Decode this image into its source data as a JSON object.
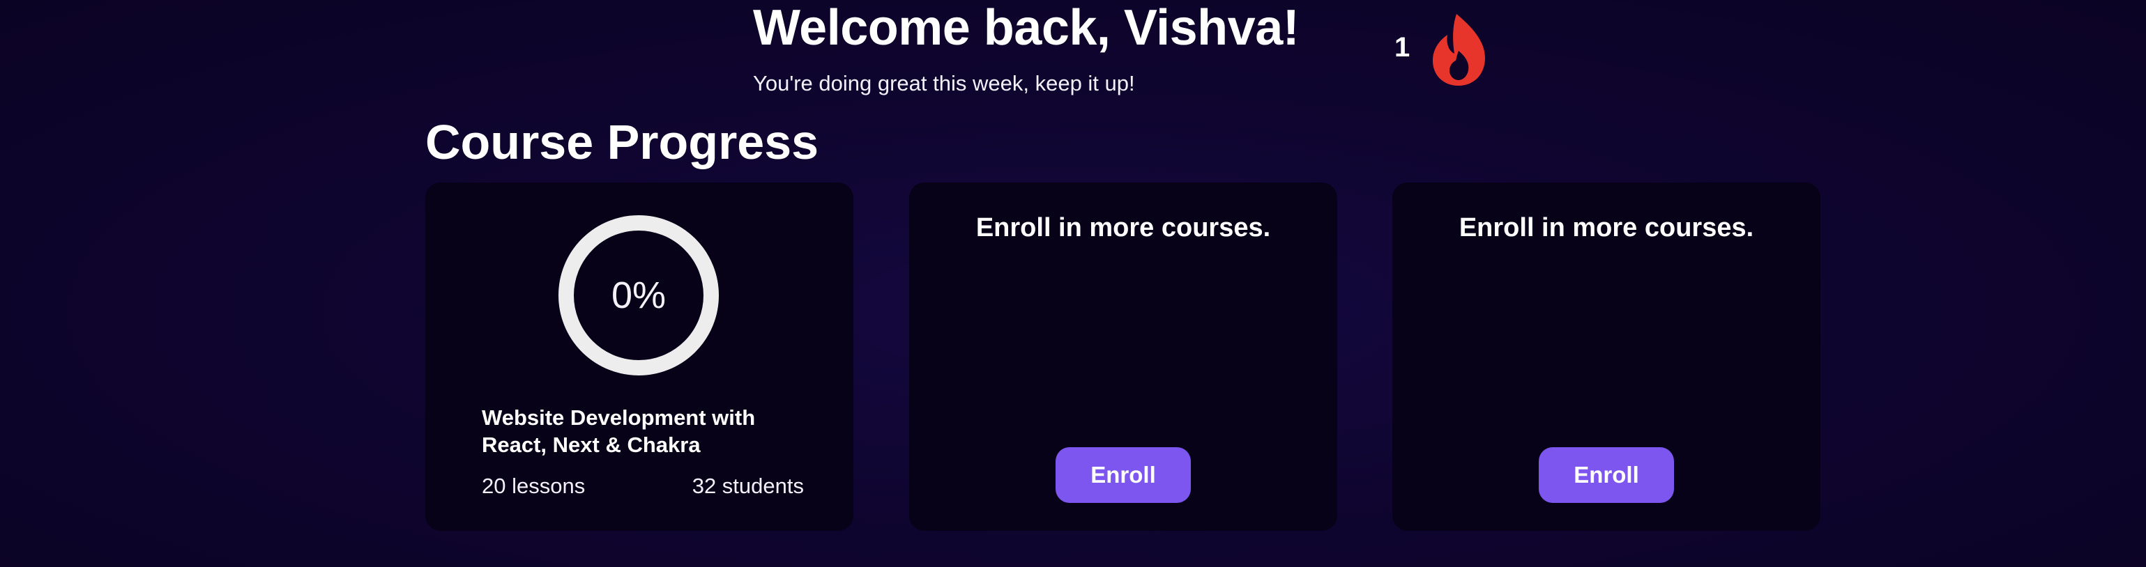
{
  "header": {
    "title": "Welcome back, Vishva!",
    "subtitle": "You're doing great this week, keep it up!",
    "streak_count": "1",
    "streak_icon": "fire-icon"
  },
  "section": {
    "title": "Course Progress"
  },
  "course_card": {
    "progress": 0,
    "progress_label": "0%",
    "title": "Website Development with React, Next & Chakra",
    "lessons": "20 lessons",
    "students": "32 students"
  },
  "enroll_cards": [
    {
      "text": "Enroll in more courses.",
      "button_label": "Enroll"
    },
    {
      "text": "Enroll in more courses.",
      "button_label": "Enroll"
    }
  ],
  "colors": {
    "background": "#0f0530",
    "card": "#070218",
    "accent": "#7c56ee",
    "ring": "#eeeded",
    "fire": "#e8352b"
  }
}
